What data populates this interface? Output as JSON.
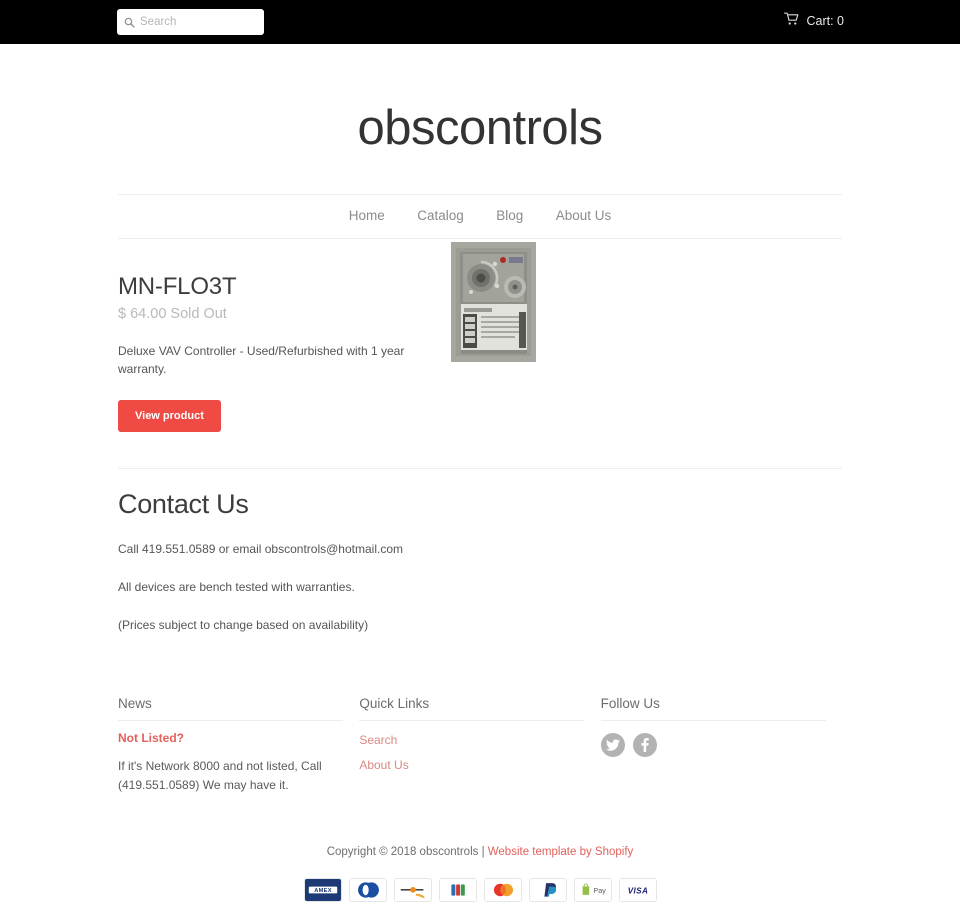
{
  "topbar": {
    "search": {
      "placeholder": "Search",
      "value": "",
      "icon": "search-icon"
    },
    "cart": {
      "label": "Cart: 0",
      "icon": "shopping-cart-icon"
    }
  },
  "header": {
    "logo": "obscontrols"
  },
  "nav": {
    "items": [
      {
        "label": "Home"
      },
      {
        "label": "Catalog"
      },
      {
        "label": "Blog"
      },
      {
        "label": "About Us"
      }
    ]
  },
  "product": {
    "title": "MN-FLO3T",
    "price": "$ 64.00 Sold Out",
    "description": "Deluxe VAV Controller - Used/Refurbished with 1 year warranty.",
    "button_label": "View product",
    "image_alt": "MN-FLO3T VAV controller board photo"
  },
  "contact": {
    "title": "Contact Us",
    "paragraphs": [
      "Call 419.551.0589 or email obscontrols@hotmail.com",
      "All devices are bench tested with warranties.",
      "(Prices subject to change based on availability)"
    ]
  },
  "footer": {
    "news": {
      "title": "News",
      "headline": "Not Listed?",
      "body": "If it's Network 8000 and not listed, Call (419.551.0589)  We may have it."
    },
    "quick_links": {
      "title": "Quick Links",
      "items": [
        {
          "label": "Search"
        },
        {
          "label": "About Us"
        }
      ]
    },
    "follow": {
      "title": "Follow Us",
      "items": [
        {
          "name": "twitter-icon"
        },
        {
          "name": "facebook-icon"
        }
      ]
    },
    "copyright_text": "Copyright © 2018 obscontrols | ",
    "copyright_link": "Website template by Shopify",
    "payments": [
      {
        "name": "amex-icon",
        "label": "AMEX"
      },
      {
        "name": "diners-club-icon",
        "label": "Diners Club"
      },
      {
        "name": "discover-icon",
        "label": "Discover"
      },
      {
        "name": "jcb-icon",
        "label": "JCB"
      },
      {
        "name": "mastercard-icon",
        "label": "Mastercard"
      },
      {
        "name": "paypal-icon",
        "label": "PayPal"
      },
      {
        "name": "shop-pay-icon",
        "label": "Pay"
      },
      {
        "name": "visa-icon",
        "label": "VISA"
      }
    ]
  },
  "colors": {
    "accent_red": "#ef4a43",
    "link_red": "#e2615c",
    "topbar_bg": "#000000",
    "text_dark": "#3d3d3d",
    "text_muted": "#8c8c8c"
  }
}
